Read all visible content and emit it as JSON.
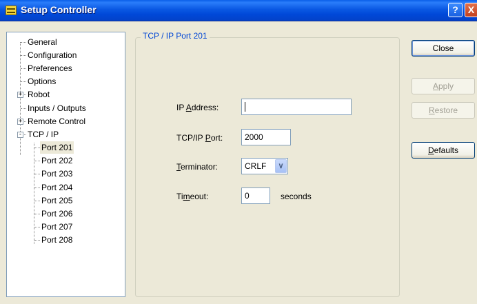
{
  "window": {
    "title": "Setup Controller"
  },
  "titlebar": {
    "help_label": "?",
    "close_label": "X"
  },
  "tree": {
    "items": [
      {
        "label": "General"
      },
      {
        "label": "Configuration"
      },
      {
        "label": "Preferences"
      },
      {
        "label": "Options"
      },
      {
        "label": "Robot",
        "expander": "+"
      },
      {
        "label": "Inputs / Outputs"
      },
      {
        "label": "Remote Control",
        "expander": "+"
      },
      {
        "label": "TCP / IP",
        "expander": "-"
      },
      {
        "label": "Port 201",
        "selected": true
      },
      {
        "label": "Port 202"
      },
      {
        "label": "Port 203"
      },
      {
        "label": "Port 204"
      },
      {
        "label": "Port 205"
      },
      {
        "label": "Port 206"
      },
      {
        "label": "Port 207"
      },
      {
        "label": "Port 208"
      }
    ]
  },
  "group": {
    "title": "TCP / IP Port 201"
  },
  "form": {
    "ip": {
      "pre": "IP ",
      "ul": "A",
      "post": "ddress:",
      "value": ""
    },
    "port": {
      "pre": "TCP/IP ",
      "ul": "P",
      "post": "ort:",
      "value": "2000"
    },
    "terminator": {
      "pre": "",
      "ul": "T",
      "post": "erminator:",
      "value": "CRLF"
    },
    "timeout": {
      "pre": "Ti",
      "ul": "m",
      "post": "eout:",
      "value": "0",
      "unit": "seconds"
    }
  },
  "buttons": {
    "close": {
      "label": "Close"
    },
    "apply": {
      "ul": "A",
      "rest": "pply"
    },
    "restore": {
      "ul": "R",
      "rest": "estore"
    },
    "defaults": {
      "ul": "D",
      "rest": "efaults"
    }
  }
}
